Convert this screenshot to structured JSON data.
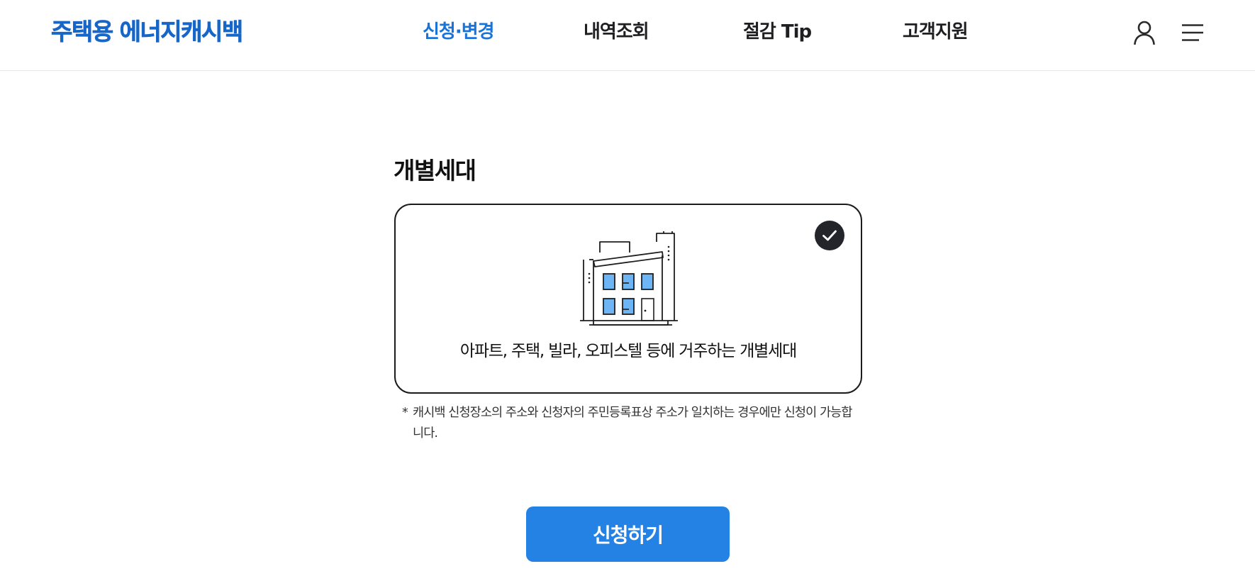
{
  "header": {
    "logo": "주택용 에너지캐시백",
    "nav": [
      {
        "label": "신청·변경",
        "active": true
      },
      {
        "label": "내역조회",
        "active": false
      },
      {
        "label": "절감 Tip",
        "active": false
      },
      {
        "label": "고객지원",
        "active": false
      }
    ],
    "icons": [
      "user-icon",
      "menu-icon"
    ]
  },
  "main": {
    "section_title": "개별세대",
    "card": {
      "description": "아파트, 주택, 빌라, 오피스텔 등에 거주하는 개별세대",
      "selected": true,
      "icon": "building-icon"
    },
    "notice_mark": "*",
    "notice_text": "캐시백 신청장소의 주소와 신청자의 주민등록표상 주소가 일치하는 경우에만 신청이 가능합니다.",
    "apply_button": "신청하기"
  },
  "colors": {
    "accent": "#1A73D9",
    "button": "#2382E4",
    "logo": "#1766C8",
    "check_badge": "#23252B",
    "window_fill": "#6EB5F5"
  }
}
